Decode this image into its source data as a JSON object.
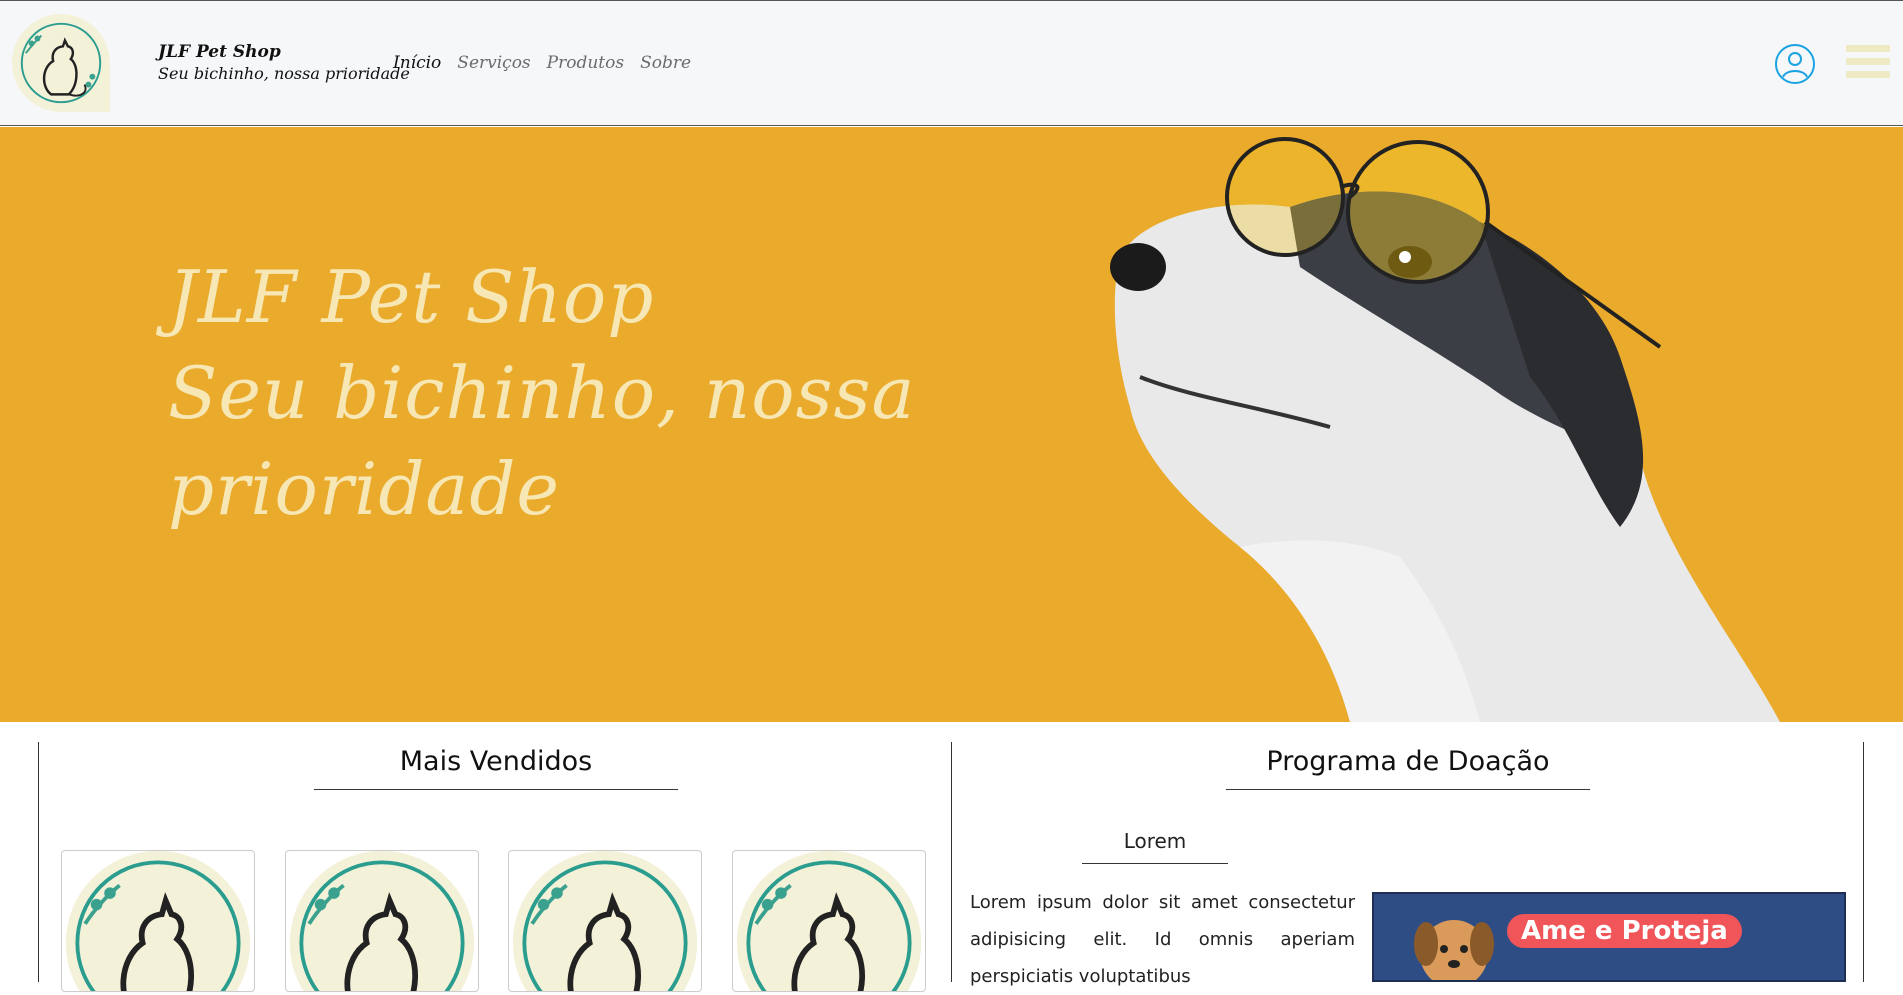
{
  "navbar": {
    "brand_name": "JLF Pet Shop",
    "brand_tagline": "Seu bichinho, nossa prioridade",
    "links": [
      {
        "label": "Início",
        "active": true
      },
      {
        "label": "Serviços",
        "active": false
      },
      {
        "label": "Produtos",
        "active": false
      },
      {
        "label": "Sobre",
        "active": false
      }
    ],
    "user_icon": "user-circle-icon",
    "menu_icon": "hamburger-menu-icon"
  },
  "hero": {
    "title_line1": "JLF Pet Shop",
    "title_line2": "Seu bichinho, nossa prioridade",
    "background_color": "#eaaa2c",
    "text_color": "#f6e7b4"
  },
  "best_sellers": {
    "title": "Mais Vendidos",
    "products": [
      {
        "image": "cat-logo"
      },
      {
        "image": "cat-logo"
      },
      {
        "image": "cat-logo"
      },
      {
        "image": "cat-logo"
      }
    ]
  },
  "donation": {
    "title": "Programa de Doação",
    "subtitle": "Lorem",
    "body": "Lorem ipsum dolor sit amet consectetur adipisicing elit. Id omnis aperiam perspiciatis voluptatibus",
    "banner_text": "Ame e Proteja"
  },
  "colors": {
    "accent_teal": "#2a9d8f",
    "logo_bg": "#f4f1d9",
    "user_icon": "#1aa3e0"
  }
}
